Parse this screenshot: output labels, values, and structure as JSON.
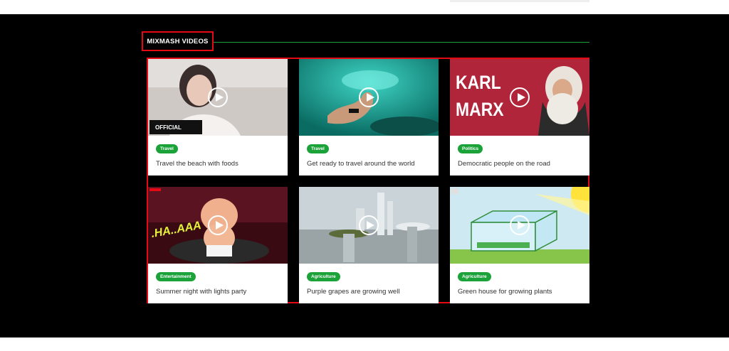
{
  "section": {
    "heading": "MIXMASH VIDEOS"
  },
  "colors": {
    "accent_red": "#e50914",
    "accent_green": "#1ba33a",
    "background": "#000000"
  },
  "videos": [
    {
      "category": "Travel",
      "title": "Travel the beach with foods",
      "thumbnail_overlay": "OFFICIAL",
      "icon": "play-icon"
    },
    {
      "category": "Travel",
      "title": "Get ready to travel around the world",
      "icon": "play-icon"
    },
    {
      "category": "Politics",
      "title": "Democratic people on the road",
      "thumbnail_overlay_line1": "KARL",
      "thumbnail_overlay_line2": "MARX",
      "icon": "play-icon"
    },
    {
      "category": "Entertainment",
      "title": "Summer night with lights party",
      "thumbnail_overlay": ".HA..AAA",
      "icon": "play-icon"
    },
    {
      "category": "Agriculture",
      "title": "Purple grapes are growing well",
      "icon": "play-icon"
    },
    {
      "category": "Agriculture",
      "title": "Green house for growing plants",
      "icon": "play-icon"
    }
  ]
}
